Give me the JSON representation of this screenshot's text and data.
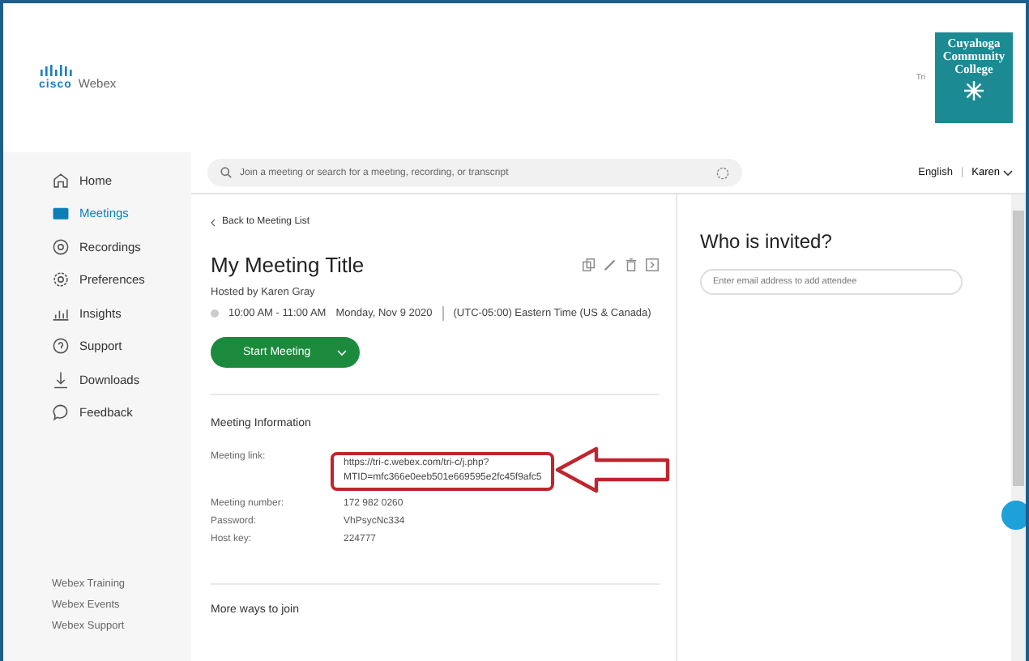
{
  "header": {
    "brand": {
      "mark": "cisco",
      "product": "Webex"
    },
    "org": {
      "prefix": "Tri",
      "name_lines": [
        "Cuyahoga",
        "Community",
        "College"
      ]
    }
  },
  "sidebar": {
    "items": [
      {
        "label": "Home",
        "kind": "home",
        "selected": false
      },
      {
        "label": "Meetings",
        "kind": "meetings",
        "selected": true
      },
      {
        "label": "Recordings",
        "kind": "recordings",
        "selected": false
      },
      {
        "label": "Preferences",
        "kind": "preferences",
        "selected": false
      },
      {
        "label": "Insights",
        "kind": "insights",
        "selected": false
      },
      {
        "label": "Support",
        "kind": "support",
        "selected": false
      },
      {
        "label": "Downloads",
        "kind": "downloads",
        "selected": false
      },
      {
        "label": "Feedback",
        "kind": "feedback",
        "selected": false
      }
    ],
    "footer_links": [
      "Webex Training",
      "Webex Events",
      "Webex Support"
    ]
  },
  "topbar": {
    "search": {
      "placeholder": "Join a meeting or search for a meeting, recording, or transcript"
    },
    "language": "English",
    "separator": "|",
    "user": "Karen"
  },
  "meeting": {
    "back_link": "Back to Meeting List",
    "title": "My Meeting Title",
    "host": "Hosted by Karen Gray",
    "time": "10:00 AM - 11:00 AM",
    "date": "Monday, Nov 9 2020",
    "timezone": "(UTC-05:00) Eastern Time (US & Canada)",
    "start_button": "Start Meeting",
    "info_heading": "Meeting Information",
    "info": [
      {
        "label": "Meeting link:",
        "value_lines": [
          "https://tri-c.webex.com/tri-c/j.php?",
          "MTID=mfc366e0eeb501e669595e2fc45f9afc5"
        ],
        "highlighted": true
      },
      {
        "label": "Meeting number:",
        "value_lines": [
          "172 982 0260"
        ],
        "highlighted": false
      },
      {
        "label": "Password:",
        "value_lines": [
          "VhPsycNc334"
        ],
        "highlighted": false
      },
      {
        "label": "Host key:",
        "value_lines": [
          "224777"
        ],
        "highlighted": false
      }
    ],
    "more_heading": "More ways to join"
  },
  "invite": {
    "title": "Who is invited?",
    "field": {
      "placeholder": "Enter email address to add attendee"
    }
  }
}
